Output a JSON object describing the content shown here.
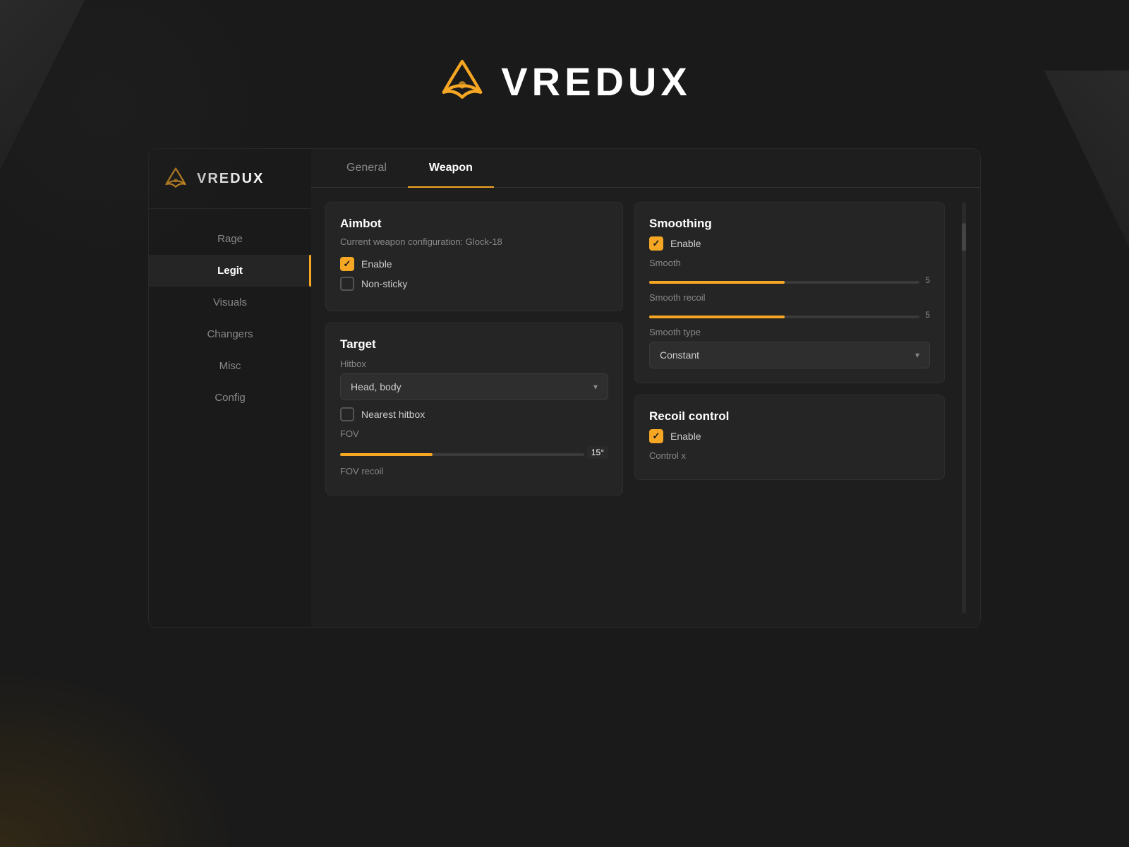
{
  "header": {
    "logo_text": "VREDUX"
  },
  "sidebar": {
    "brand_text": "VREDUX",
    "items": [
      {
        "id": "rage",
        "label": "Rage",
        "active": false
      },
      {
        "id": "legit",
        "label": "Legit",
        "active": true
      },
      {
        "id": "visuals",
        "label": "Visuals",
        "active": false
      },
      {
        "id": "changers",
        "label": "Changers",
        "active": false
      },
      {
        "id": "misc",
        "label": "Misc",
        "active": false
      },
      {
        "id": "config",
        "label": "Config",
        "active": false
      }
    ]
  },
  "tabs": [
    {
      "id": "general",
      "label": "General",
      "active": false
    },
    {
      "id": "weapon",
      "label": "Weapon",
      "active": true
    }
  ],
  "aimbot_card": {
    "title": "Aimbot",
    "subtitle": "Current weapon configuration: Glock-18",
    "enable_checked": true,
    "enable_label": "Enable",
    "nonsticky_checked": false,
    "nonsticky_label": "Non-sticky"
  },
  "target_card": {
    "title": "Target",
    "hitbox_label": "Hitbox",
    "hitbox_value": "Head, body",
    "nearest_hitbox_checked": false,
    "nearest_hitbox_label": "Nearest hitbox",
    "fov_label": "FOV",
    "fov_value": "15°",
    "fov_fill_percent": 38,
    "fov_recoil_label": "FOV recoil"
  },
  "smoothing_card": {
    "title": "Smoothing",
    "enable_checked": true,
    "enable_label": "Enable",
    "smooth_label": "Smooth",
    "smooth_value": "5",
    "smooth_fill_percent": 50,
    "smooth_recoil_label": "Smooth recoil",
    "smooth_recoil_value": "5",
    "smooth_recoil_fill_percent": 50,
    "smooth_type_label": "Smooth type",
    "smooth_type_value": "Constant"
  },
  "recoil_card": {
    "title": "Recoil control",
    "enable_checked": true,
    "enable_label": "Enable",
    "control_x_label": "Control x"
  },
  "colors": {
    "accent": "#f5a623",
    "bg_dark": "#1a1a1a",
    "bg_card": "#252525",
    "text_primary": "#ffffff",
    "text_secondary": "#888888",
    "active_sidebar_bg": "#252525"
  }
}
